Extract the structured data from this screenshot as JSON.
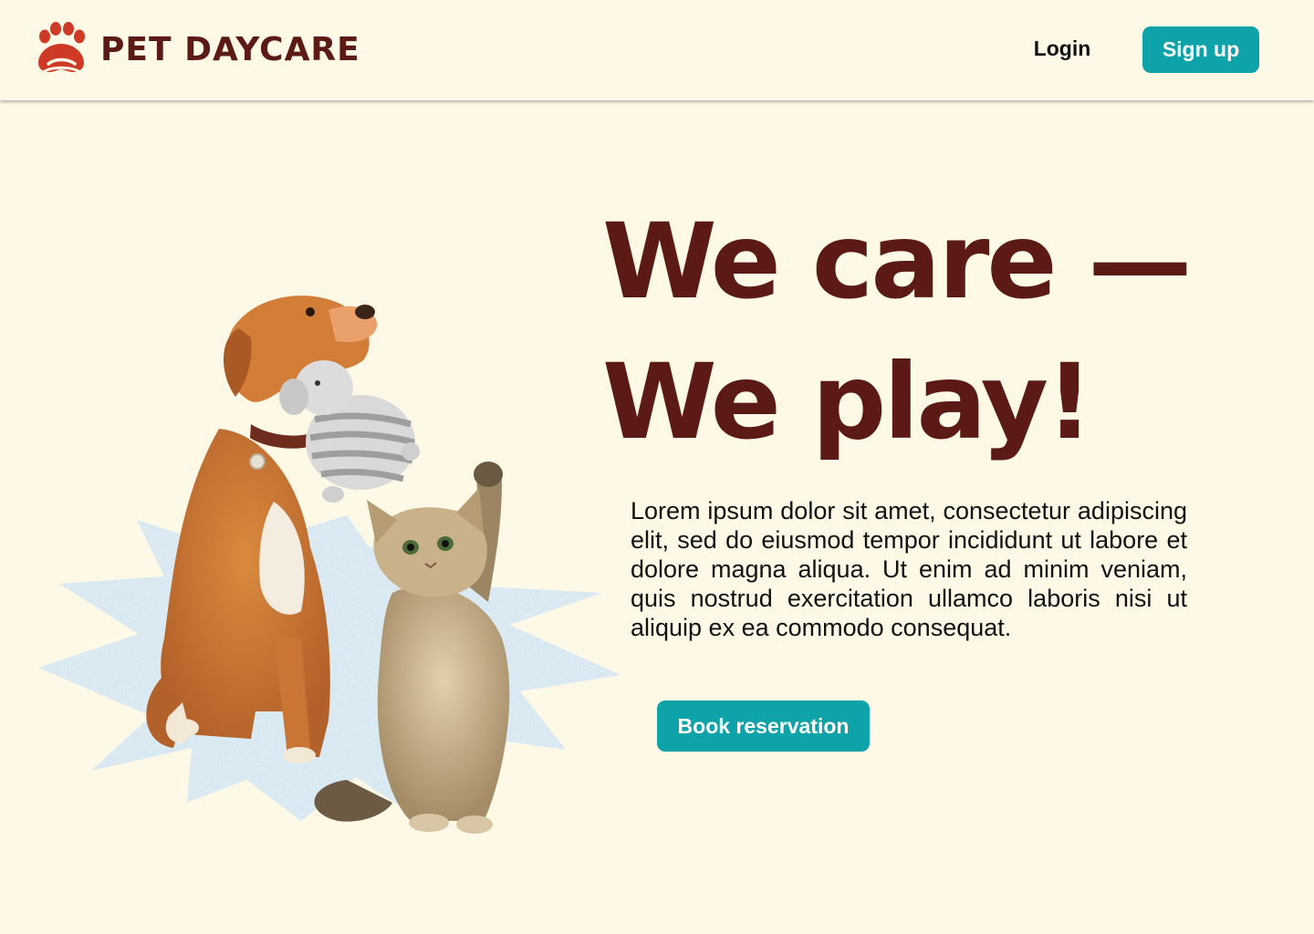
{
  "header": {
    "brand_name": "PET DAYCARE",
    "logo_icon": "paw-icon",
    "login_label": "Login",
    "signup_label": "Sign up"
  },
  "hero": {
    "heading_line1": "We care —",
    "heading_line2": "We play!",
    "body": "Lorem ipsum dolor sit amet, consectetur adipiscing elit, sed do eiusmod tempor incididunt ut labore et dolore magna aliqua. Ut enim ad minim veniam, quis nostrud exercitation ullamco laboris nisi ut aliquip ex ea commodo consequat.",
    "cta_label": "Book reservation",
    "image_subject": "dog holding a toy and a kitten reaching up"
  },
  "colors": {
    "background": "#fef9e6",
    "brand": "#5c1a16",
    "logo_red": "#cf3a26",
    "accent": "#0ea3a9",
    "burst": "#cfe3ef"
  }
}
